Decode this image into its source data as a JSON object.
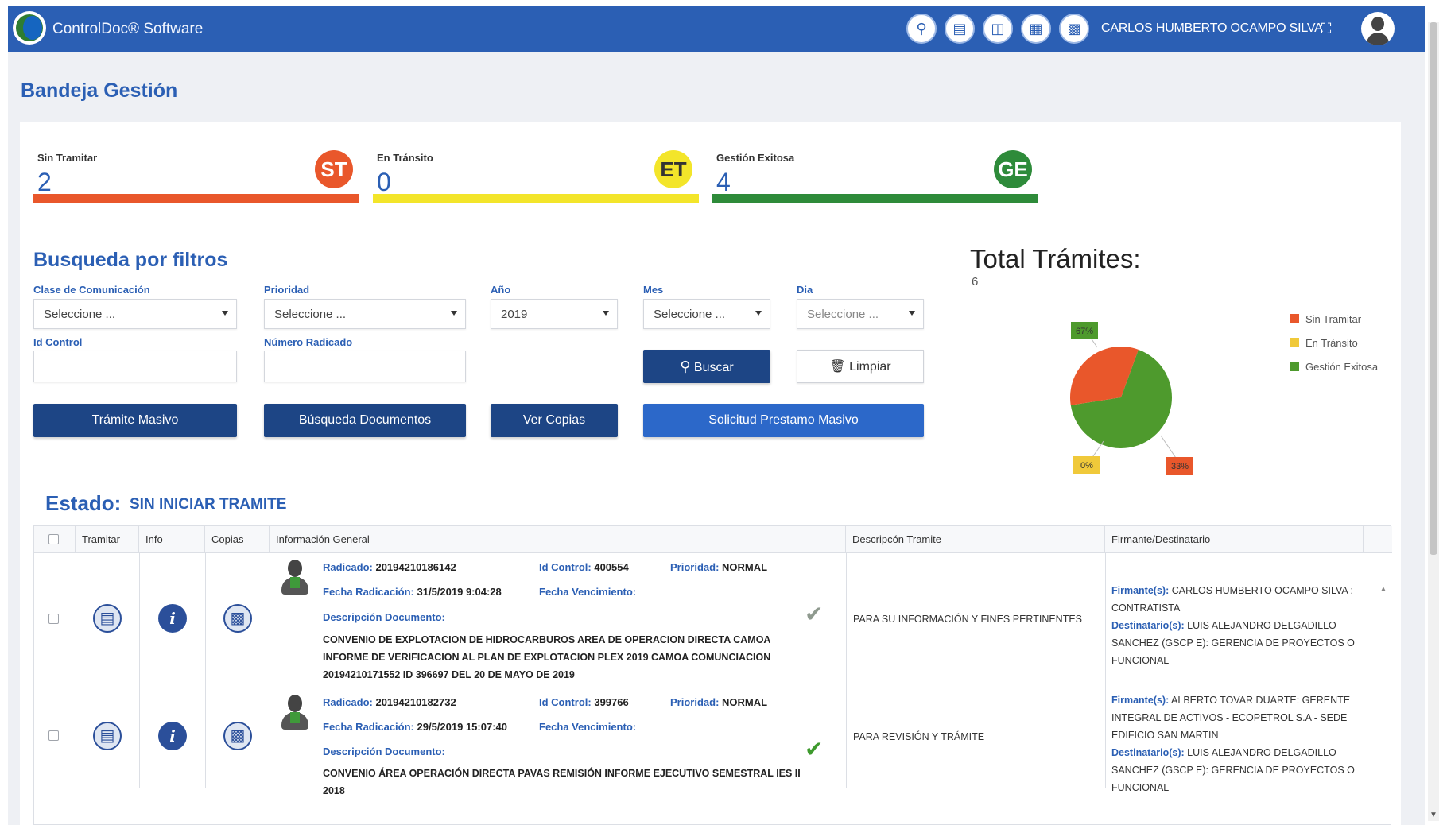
{
  "topbar": {
    "app_title": "ControlDoc® Software",
    "icons": [
      "search-icon",
      "document-icon",
      "inbox-icon",
      "report-icon",
      "certificate-icon"
    ],
    "user_name": "CARLOS HUMBERTO OCAMPO SILVA"
  },
  "page_title": "Bandeja Gestión",
  "cards": [
    {
      "label": "Sin Tramitar",
      "value": "2",
      "badge": "ST",
      "color": "#e9572b"
    },
    {
      "label": "En Tránsito",
      "value": "0",
      "badge": "ET",
      "color": "#f3e52a"
    },
    {
      "label": "Gestión Exitosa",
      "value": "4",
      "badge": "GE",
      "color": "#2e8b3a"
    }
  ],
  "filters": {
    "title": "Busqueda por filtros",
    "clase_label": "Clase de Comunicación",
    "clase_value": "Seleccione ...",
    "prioridad_label": "Prioridad",
    "prioridad_value": "Seleccione ...",
    "anio_label": "Año",
    "anio_value": "2019",
    "mes_label": "Mes",
    "mes_value": "Seleccione ...",
    "dia_label": "Dia",
    "dia_value": "Seleccione ...",
    "id_control_label": "Id Control",
    "id_control_value": "",
    "numero_label": "Número Radicado",
    "numero_value": "",
    "buscar": "Buscar",
    "limpiar": "Limpiar"
  },
  "actions": {
    "tramite_masivo": "Trámite Masivo",
    "busqueda_documentos": "Búsqueda Documentos",
    "ver_copias": "Ver Copias",
    "solicitud_prestamo": "Solicitud Prestamo Masivo"
  },
  "chart_data": {
    "type": "pie",
    "title": "Total Trámites:",
    "total": "6",
    "slices": [
      {
        "name": "Sin Tramitar",
        "value": 33,
        "label": "33%",
        "color": "#e9572b"
      },
      {
        "name": "En Tránsito",
        "value": 0,
        "label": "0%",
        "color": "#f0c93a"
      },
      {
        "name": "Gestión Exitosa",
        "value": 67,
        "label": "67%",
        "color": "#4e9a2d"
      }
    ],
    "legend_position": "right"
  },
  "estado": {
    "label": "Estado:",
    "value": "SIN INICIAR TRAMITE"
  },
  "table": {
    "headers": [
      "Tramitar",
      "Info",
      "Copias",
      "Información General",
      "Descripcón Tramite",
      "Firmante/Destinatario"
    ],
    "labels": {
      "radicado": "Radicado:",
      "id_control": "Id Control:",
      "prioridad": "Prioridad:",
      "fecha_radicacion": "Fecha Radicación:",
      "fecha_vencimiento": "Fecha Vencimiento:",
      "descripcion": "Descripción Documento:",
      "firmante": "Firmante(s):",
      "destinatario": "Destinatario(s):"
    },
    "rows": [
      {
        "radicado": "20194210186142",
        "id_control": "400554",
        "prioridad": "NORMAL",
        "fecha_radicacion": "31/5/2019 9:04:28",
        "fecha_vencimiento": "",
        "descripcion": "CONVENIO DE EXPLOTACION DE HIDROCARBUROS AREA DE OPERACION DIRECTA CAMOA INFORME DE VERIFICACION AL PLAN DE EXPLOTACION PLEX 2019 CAMOA COMUNCIACION 20194210171552 ID 396697 DEL 20 DE MAYO DE 2019",
        "tramite": "PARA SU INFORMACIÓN Y FINES PERTINENTES",
        "firmante": "CARLOS HUMBERTO OCAMPO SILVA : CONTRATISTA",
        "destinatario": "LUIS ALEJANDRO DELGADILLO SANCHEZ (GSCP E): GERENCIA DE PROYECTOS O FUNCIONAL",
        "check_color": "#8f9a8f"
      },
      {
        "radicado": "20194210182732",
        "id_control": "399766",
        "prioridad": "NORMAL",
        "fecha_radicacion": "29/5/2019 15:07:40",
        "fecha_vencimiento": "",
        "descripcion": "CONVENIO ÁREA OPERACIÓN DIRECTA PAVAS REMISIÓN INFORME EJECUTIVO SEMESTRAL IES II 2018",
        "tramite": "PARA REVISIÓN Y TRÁMITE",
        "firmante": "ALBERTO TOVAR DUARTE: GERENTE INTEGRAL DE ACTIVOS - ECOPETROL S.A - SEDE EDIFICIO SAN MARTIN",
        "destinatario": "LUIS ALEJANDRO DELGADILLO SANCHEZ (GSCP E): GERENCIA DE PROYECTOS O FUNCIONAL",
        "check_color": "#3e9a2e"
      }
    ]
  }
}
